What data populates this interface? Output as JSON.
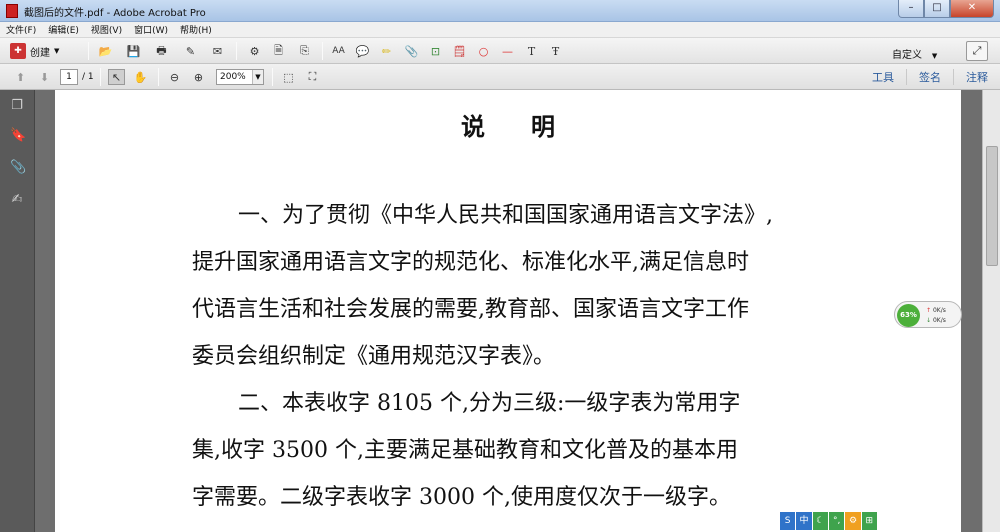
{
  "window": {
    "title": "截图后的文件.pdf - Adobe Acrobat Pro",
    "minimize": "–",
    "maximize": "□",
    "close": "✕"
  },
  "menu": [
    "文件(F)",
    "编辑(E)",
    "视图(V)",
    "窗口(W)",
    "帮助(H)"
  ],
  "toolbar": {
    "create_label": "创建",
    "custom_label": "自定义"
  },
  "nav": {
    "page_current": "1",
    "page_total": "/ 1",
    "zoom": "200%"
  },
  "panels": {
    "tools": "工具",
    "sign": "签名",
    "comment": "注释"
  },
  "document": {
    "title": "说明",
    "para1_line1": "一、为了贯彻《中华人民共和国国家通用语言文字法》,",
    "para1_line2": "提升国家通用语言文字的规范化、标准化水平,满足信息时",
    "para1_line3": "代语言生活和社会发展的需要,教育部、国家语言文字工作",
    "para1_line4": "委员会组织制定《通用规范汉字表》。",
    "para2_line1": "二、本表收字 8105 个,分为三级:一级字表为常用字",
    "para2_line2": "集,收字 3500 个,主要满足基础教育和文化普及的基本用",
    "para2_line3": "字需要。二级字表收字 3000 个,使用度仅次于一级字。"
  },
  "netwidget": {
    "percent": "63%",
    "up": "0K/s",
    "down": "0K/s"
  },
  "ime": [
    "中",
    "☾",
    "°,",
    "⚙",
    "⊞"
  ]
}
